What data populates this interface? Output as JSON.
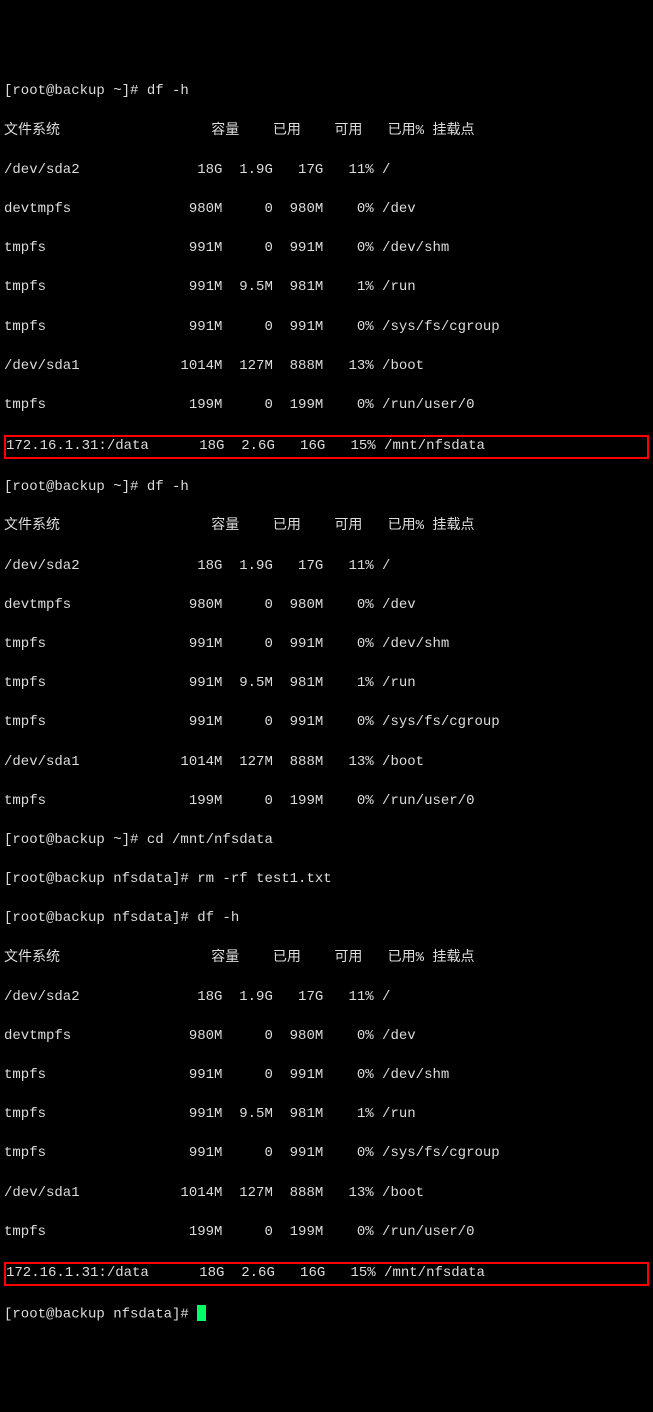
{
  "prompts": {
    "p1": "[root@backup ~]# df -h",
    "p2": "[root@backup ~]# df -h",
    "p3": "[root@backup ~]# cd /mnt/nfsdata",
    "p4": "[root@backup nfsdata]# rm -rf test1.txt",
    "p5": "[root@backup nfsdata]# df -h",
    "p6": "[root@backup nfsdata]# "
  },
  "header": {
    "fs": "文件系统",
    "size": "容量",
    "used": "已用",
    "avail": "可用",
    "usep": "已用%",
    "mount": "挂载点"
  },
  "df1": {
    "r0": {
      "fs": "/dev/sda2",
      "size": "18G",
      "used": "1.9G",
      "avail": "17G",
      "usep": "11%",
      "mount": "/"
    },
    "r1": {
      "fs": "devtmpfs",
      "size": "980M",
      "used": "0",
      "avail": "980M",
      "usep": "0%",
      "mount": "/dev"
    },
    "r2": {
      "fs": "tmpfs",
      "size": "991M",
      "used": "0",
      "avail": "991M",
      "usep": "0%",
      "mount": "/dev/shm"
    },
    "r3": {
      "fs": "tmpfs",
      "size": "991M",
      "used": "9.5M",
      "avail": "981M",
      "usep": "1%",
      "mount": "/run"
    },
    "r4": {
      "fs": "tmpfs",
      "size": "991M",
      "used": "0",
      "avail": "991M",
      "usep": "0%",
      "mount": "/sys/fs/cgroup"
    },
    "r5": {
      "fs": "/dev/sda1",
      "size": "1014M",
      "used": "127M",
      "avail": "888M",
      "usep": "13%",
      "mount": "/boot"
    },
    "r6": {
      "fs": "tmpfs",
      "size": "199M",
      "used": "0",
      "avail": "199M",
      "usep": "0%",
      "mount": "/run/user/0"
    },
    "r7": {
      "fs": "172.16.1.31:/data",
      "size": "18G",
      "used": "2.6G",
      "avail": "16G",
      "usep": "15%",
      "mount": "/mnt/nfsdata"
    }
  },
  "df2": {
    "r0": {
      "fs": "/dev/sda2",
      "size": "18G",
      "used": "1.9G",
      "avail": "17G",
      "usep": "11%",
      "mount": "/"
    },
    "r1": {
      "fs": "devtmpfs",
      "size": "980M",
      "used": "0",
      "avail": "980M",
      "usep": "0%",
      "mount": "/dev"
    },
    "r2": {
      "fs": "tmpfs",
      "size": "991M",
      "used": "0",
      "avail": "991M",
      "usep": "0%",
      "mount": "/dev/shm"
    },
    "r3": {
      "fs": "tmpfs",
      "size": "991M",
      "used": "9.5M",
      "avail": "981M",
      "usep": "1%",
      "mount": "/run"
    },
    "r4": {
      "fs": "tmpfs",
      "size": "991M",
      "used": "0",
      "avail": "991M",
      "usep": "0%",
      "mount": "/sys/fs/cgroup"
    },
    "r5": {
      "fs": "/dev/sda1",
      "size": "1014M",
      "used": "127M",
      "avail": "888M",
      "usep": "13%",
      "mount": "/boot"
    },
    "r6": {
      "fs": "tmpfs",
      "size": "199M",
      "used": "0",
      "avail": "199M",
      "usep": "0%",
      "mount": "/run/user/0"
    }
  },
  "df3": {
    "r0": {
      "fs": "/dev/sda2",
      "size": "18G",
      "used": "1.9G",
      "avail": "17G",
      "usep": "11%",
      "mount": "/"
    },
    "r1": {
      "fs": "devtmpfs",
      "size": "980M",
      "used": "0",
      "avail": "980M",
      "usep": "0%",
      "mount": "/dev"
    },
    "r2": {
      "fs": "tmpfs",
      "size": "991M",
      "used": "0",
      "avail": "991M",
      "usep": "0%",
      "mount": "/dev/shm"
    },
    "r3": {
      "fs": "tmpfs",
      "size": "991M",
      "used": "9.5M",
      "avail": "981M",
      "usep": "1%",
      "mount": "/run"
    },
    "r4": {
      "fs": "tmpfs",
      "size": "991M",
      "used": "0",
      "avail": "991M",
      "usep": "0%",
      "mount": "/sys/fs/cgroup"
    },
    "r5": {
      "fs": "/dev/sda1",
      "size": "1014M",
      "used": "127M",
      "avail": "888M",
      "usep": "13%",
      "mount": "/boot"
    },
    "r6": {
      "fs": "tmpfs",
      "size": "199M",
      "used": "0",
      "avail": "199M",
      "usep": "0%",
      "mount": "/run/user/0"
    },
    "r7": {
      "fs": "172.16.1.31:/data",
      "size": "18G",
      "used": "2.6G",
      "avail": "16G",
      "usep": "15%",
      "mount": "/mnt/nfsdata"
    }
  }
}
